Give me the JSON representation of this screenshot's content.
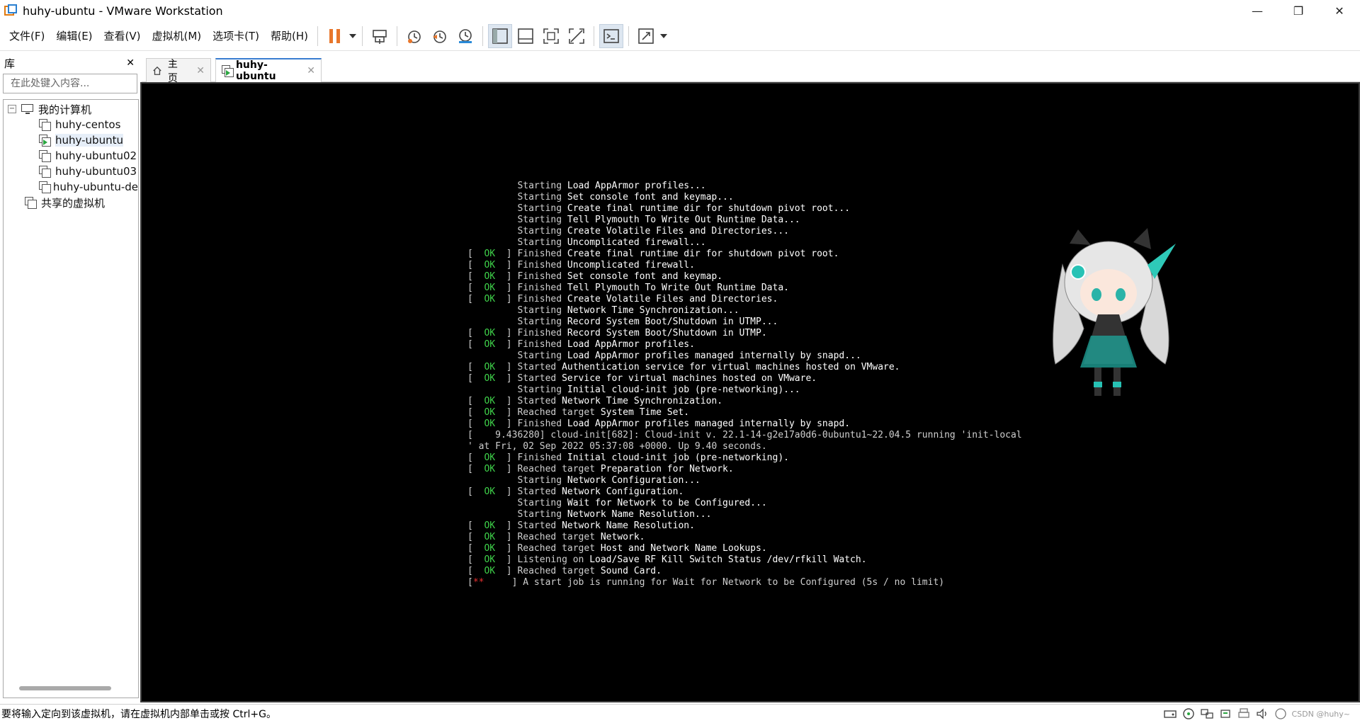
{
  "window": {
    "title": "huhy-ubuntu - VMware Workstation",
    "minimize": "—",
    "restore": "❐",
    "close": "✕"
  },
  "menu": [
    "文件(F)",
    "编辑(E)",
    "查看(V)",
    "虚拟机(M)",
    "选项卡(T)",
    "帮助(H)"
  ],
  "toolbar": {
    "icons": [
      "pause-icon",
      "send-ctrl-alt-del-icon",
      "snapshot-icon",
      "revert-snapshot-icon",
      "snapshot-manager-icon",
      "show-library-icon",
      "thumbnail-bar-icon",
      "full-screen-icon",
      "unity-icon",
      "console-view-icon",
      "stretch-icon"
    ],
    "accent_orange": "#e8762b"
  },
  "library": {
    "title": "库",
    "close": "✕",
    "search_placeholder": "在此处键入内容...",
    "root": "我的计算机",
    "vms": [
      "huhy-centos",
      "huhy-ubuntu",
      "huhy-ubuntu02",
      "huhy-ubuntu03",
      "huhy-ubuntu-de"
    ],
    "selected_vm": "huhy-ubuntu",
    "shared": "共享的虚拟机"
  },
  "tabs": [
    {
      "label": "主页",
      "close": "✕"
    },
    {
      "label": "huhy-ubuntu",
      "close": "✕"
    }
  ],
  "console": {
    "background": "#000000",
    "ok_color": "#3fd24a",
    "lines": [
      {
        "s": "",
        "w": "Starting",
        "t": "Load AppArmor profiles..."
      },
      {
        "s": "",
        "w": "Starting",
        "t": "Set console font and keymap..."
      },
      {
        "s": "",
        "w": "Starting",
        "t": "Create final runtime dir for shutdown pivot root..."
      },
      {
        "s": "",
        "w": "Starting",
        "t": "Tell Plymouth To Write Out Runtime Data..."
      },
      {
        "s": "",
        "w": "Starting",
        "t": "Create Volatile Files and Directories..."
      },
      {
        "s": "",
        "w": "Starting",
        "t": "Uncomplicated firewall..."
      },
      {
        "s": "OK",
        "w": "Finished",
        "t": "Create final runtime dir for shutdown pivot root."
      },
      {
        "s": "OK",
        "w": "Finished",
        "t": "Uncomplicated firewall."
      },
      {
        "s": "OK",
        "w": "Finished",
        "t": "Set console font and keymap."
      },
      {
        "s": "OK",
        "w": "Finished",
        "t": "Tell Plymouth To Write Out Runtime Data."
      },
      {
        "s": "OK",
        "w": "Finished",
        "t": "Create Volatile Files and Directories."
      },
      {
        "s": "",
        "w": "Starting",
        "t": "Network Time Synchronization..."
      },
      {
        "s": "",
        "w": "Starting",
        "t": "Record System Boot/Shutdown in UTMP..."
      },
      {
        "s": "OK",
        "w": "Finished",
        "t": "Record System Boot/Shutdown in UTMP."
      },
      {
        "s": "OK",
        "w": "Finished",
        "t": "Load AppArmor profiles."
      },
      {
        "s": "",
        "w": "Starting",
        "t": "Load AppArmor profiles managed internally by snapd..."
      },
      {
        "s": "OK",
        "w": "Started",
        "t": "Authentication service for virtual machines hosted on VMware."
      },
      {
        "s": "OK",
        "w": "Started",
        "t": "Service for virtual machines hosted on VMware."
      },
      {
        "s": "",
        "w": "Starting",
        "t": "Initial cloud-init job (pre-networking)..."
      },
      {
        "s": "OK",
        "w": "Started",
        "t": "Network Time Synchronization."
      },
      {
        "s": "OK",
        "w": "Reached target",
        "t": "System Time Set."
      },
      {
        "s": "OK",
        "w": "Finished",
        "t": "Load AppArmor profiles managed internally by snapd."
      },
      {
        "s": "RAW",
        "w": "",
        "t": "[    9.436280] cloud-init[682]: Cloud-init v. 22.1-14-g2e17a0d6-0ubuntu1~22.04.5 running 'init-local"
      },
      {
        "s": "RAW",
        "w": "",
        "t": "' at Fri, 02 Sep 2022 05:37:08 +0000. Up 9.40 seconds."
      },
      {
        "s": "OK",
        "w": "Finished",
        "t": "Initial cloud-init job (pre-networking)."
      },
      {
        "s": "OK",
        "w": "Reached target",
        "t": "Preparation for Network."
      },
      {
        "s": "",
        "w": "Starting",
        "t": "Network Configuration..."
      },
      {
        "s": "OK",
        "w": "Started",
        "t": "Network Configuration."
      },
      {
        "s": "",
        "w": "Starting",
        "t": "Wait for Network to be Configured..."
      },
      {
        "s": "",
        "w": "Starting",
        "t": "Network Name Resolution..."
      },
      {
        "s": "OK",
        "w": "Started",
        "t": "Network Name Resolution."
      },
      {
        "s": "OK",
        "w": "Reached target",
        "t": "Network."
      },
      {
        "s": "OK",
        "w": "Reached target",
        "t": "Host and Network Name Lookups."
      },
      {
        "s": "OK",
        "w": "Listening on",
        "t": "Load/Save RF Kill Switch Status /dev/rfkill Watch."
      },
      {
        "s": "OK",
        "w": "Reached target",
        "t": "Sound Card."
      },
      {
        "s": "JOB",
        "w": "",
        "t": "A start job is running for Wait for Network to be Configured (5s / no limit)"
      }
    ]
  },
  "status": {
    "message": "要将输入定向到该虚拟机，请在虚拟机内部单击或按 Ctrl+G。",
    "icons": [
      "hdd-icon",
      "cd-icon",
      "network-icon",
      "usb-icon",
      "printer-icon",
      "sound-icon",
      "display-icon"
    ],
    "watermark": "CSDN @huhy~"
  }
}
